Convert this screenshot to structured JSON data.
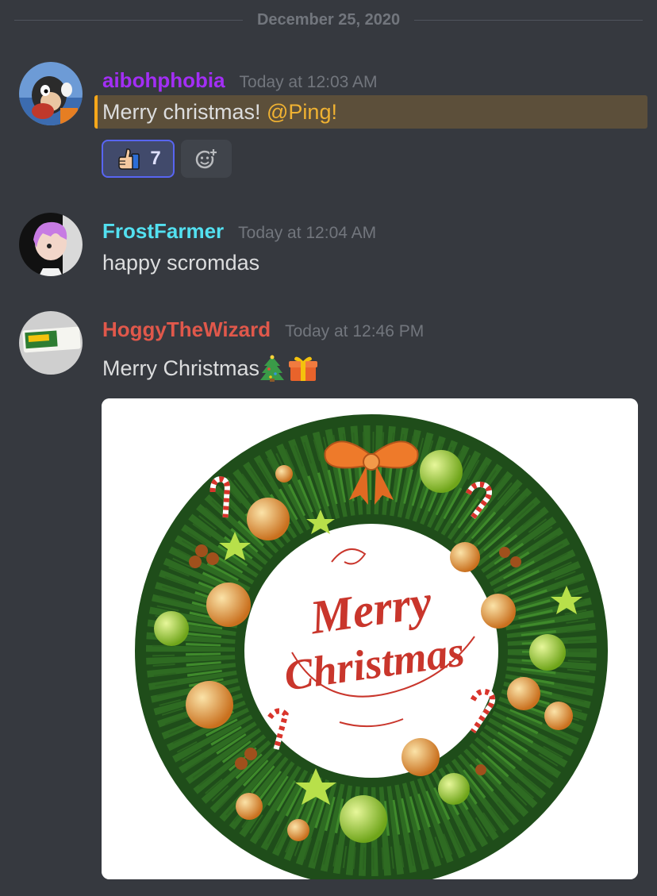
{
  "date_divider": "December 25, 2020",
  "messages": [
    {
      "username": "aibohphobia",
      "username_color": "#a32ef5",
      "timestamp": "Today at 12:03 AM",
      "text": "Merry christmas! ",
      "mention": "@Ping!",
      "reactions": [
        {
          "emoji": "thumbs-up-icon",
          "count": "7"
        }
      ]
    },
    {
      "username": "FrostFarmer",
      "username_color": "#53e0f0",
      "timestamp": "Today at 12:04 AM",
      "text": "happy scromdas"
    },
    {
      "username": "HoggyTheWizard",
      "username_color": "#e0584b",
      "timestamp": "Today at 12:46 PM",
      "text": "Merry Christmas ",
      "emojis": [
        "christmas-tree-icon",
        "gift-icon"
      ],
      "image": {
        "text_line1": "Merry",
        "text_line2": "Christmas"
      }
    }
  ]
}
